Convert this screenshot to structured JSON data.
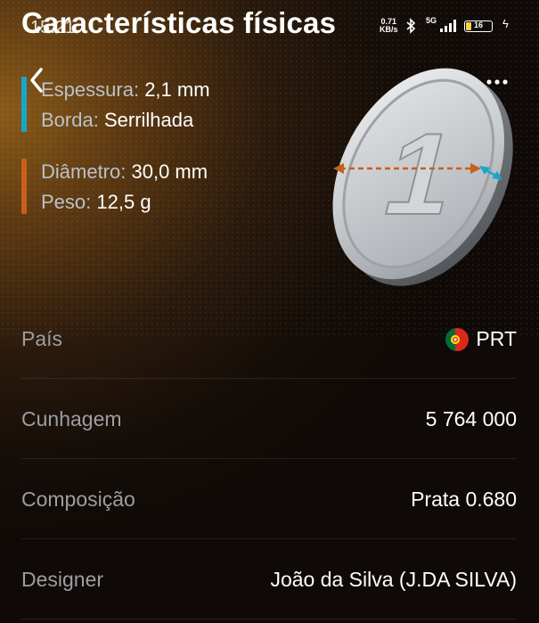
{
  "status_bar": {
    "time": "15:21",
    "net_speed_value": "0.71",
    "net_speed_unit": "KB/s",
    "network": "5G",
    "battery": "16"
  },
  "header": {
    "title": "Características físicas"
  },
  "specs": [
    {
      "key": "Espessura:",
      "value": "2,1 mm",
      "color": "#18a7c9"
    },
    {
      "key": "Borda:",
      "value": "Serrilhada",
      "color": "#18a7c9"
    },
    {
      "key": "Diâmetro:",
      "value": "30,0 mm",
      "color": "#c8601a"
    },
    {
      "key": "Peso:",
      "value": "12,5 g",
      "color": "#c8601a"
    }
  ],
  "coin": {
    "numeral": "1"
  },
  "details": [
    {
      "label": "País",
      "value": "PRT",
      "flag": "portugal-flag-icon"
    },
    {
      "label": "Cunhagem",
      "value": "5 764 000"
    },
    {
      "label": "Composição",
      "value": "Prata 0.680"
    },
    {
      "label": "Designer",
      "value": "João da Silva (J.DA SILVA)"
    }
  ],
  "colors": {
    "accent_blue": "#18a7c9",
    "accent_orange": "#c8601a",
    "label_gray": "#9c9ea2"
  }
}
